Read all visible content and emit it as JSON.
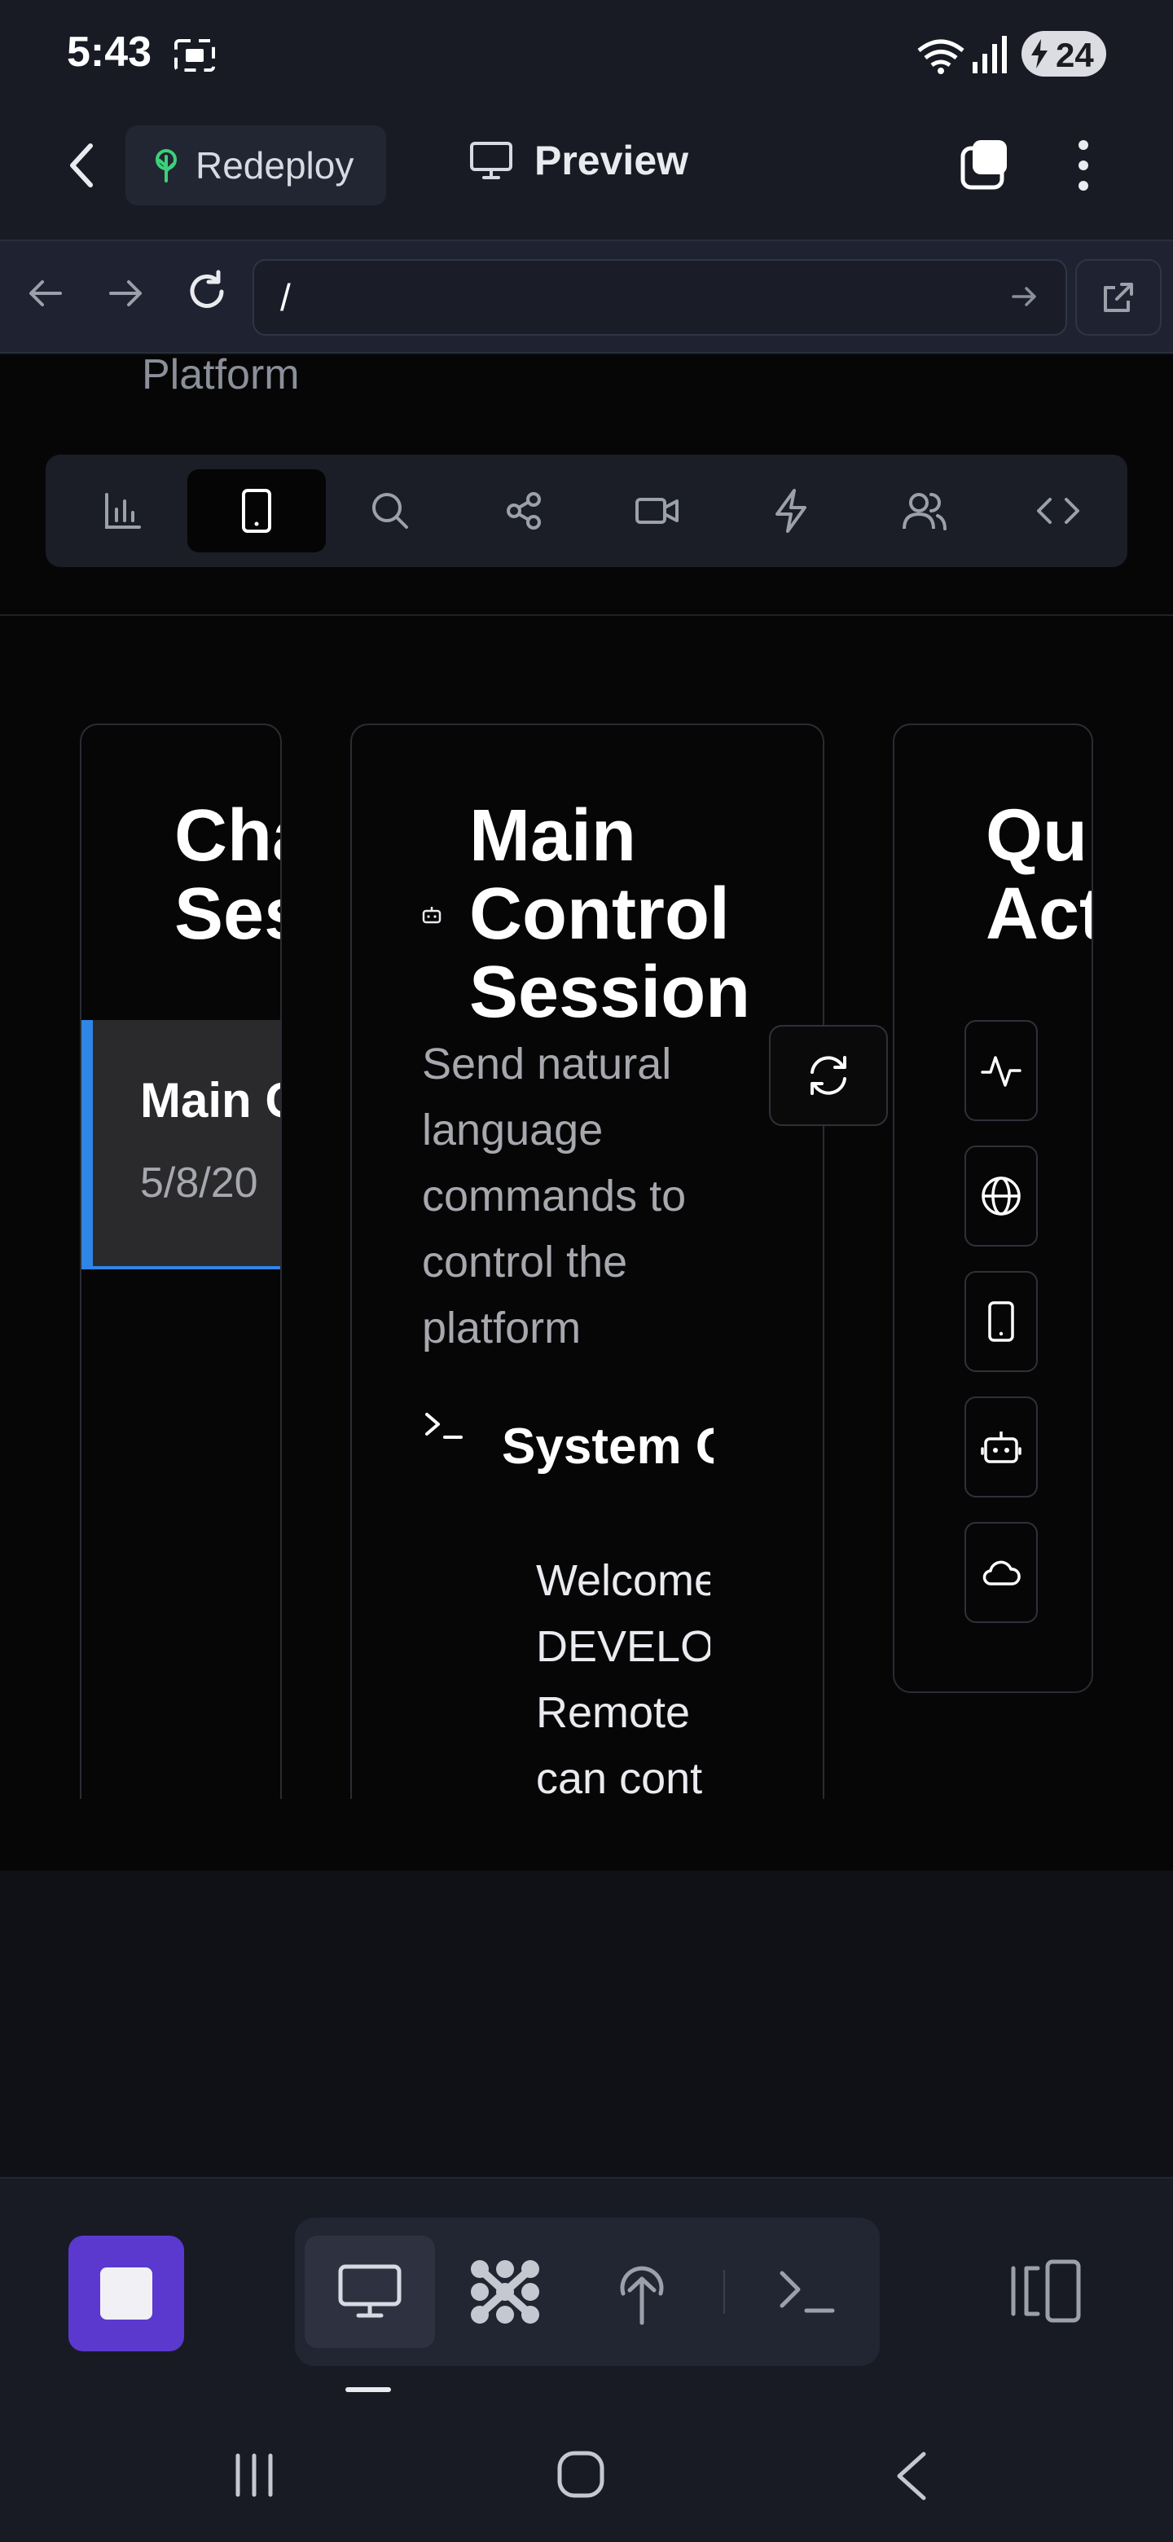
{
  "status_bar": {
    "time": "5:43",
    "battery": "24"
  },
  "header": {
    "redeploy_label": "Redeploy",
    "title": "Preview"
  },
  "browser": {
    "url": "/"
  },
  "page": {
    "platform_text": "Platform",
    "toolbar_icons": [
      "bar-chart-icon",
      "mobile-icon",
      "search-icon",
      "share-icon",
      "video-icon",
      "zap-icon",
      "users-icon",
      "code-icon"
    ],
    "active_tool": "mobile-icon"
  },
  "chat_sessions": {
    "title_line1": "Chat",
    "title_line2": "Sessi",
    "item_name": "Main C",
    "item_date": "5/8/20"
  },
  "main_session": {
    "title_line1": "Main",
    "title_line2": "Control",
    "title_line3": "Session",
    "description_lines": [
      "Send natural",
      "language",
      "commands to",
      "control the",
      "platform"
    ],
    "system_label": "System C",
    "welcome_lines": [
      "Welcome",
      "DEVELOP",
      "Remote",
      "can cont"
    ]
  },
  "quick_actions": {
    "title_line1": "Qui",
    "title_line2": "Act",
    "icons": [
      "activity-icon",
      "globe-icon",
      "tablet-icon",
      "bot-icon",
      "cloud-icon"
    ]
  },
  "bottom_bar": {
    "modes": [
      "monitor-icon",
      "apps-icon",
      "deploy-icon",
      "terminal-icon"
    ],
    "active_mode": "monitor-icon"
  },
  "colors": {
    "accent": "#5b39cf",
    "selection": "#2f86e6",
    "background": "#060607"
  }
}
